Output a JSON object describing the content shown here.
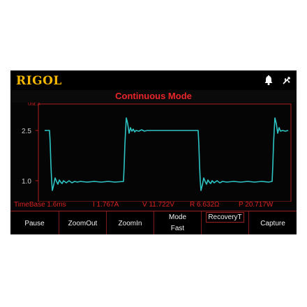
{
  "brand": "RIGOL",
  "mode_title": "Continuous Mode",
  "plot": {
    "y_unit_label": "Unit: A",
    "y_ticks": [
      "2.5",
      "1.0"
    ],
    "trace_color": "#2ec4c4",
    "frame_color": "#b01e1e"
  },
  "status": {
    "timebase": "TimeBase 1.6ms",
    "current": "I 1.767A",
    "voltage": "V 11.722V",
    "resistance": "R 6.632Ω",
    "power": "P 20.717W"
  },
  "softkeys": {
    "pause": "Pause",
    "zoom_out": "ZoomOut",
    "zoom_in": "ZoomIn",
    "mode_label": "Mode",
    "mode_value": "Fast",
    "recovery": "RecoveryT",
    "capture": "Capture"
  },
  "icons": {
    "bell": "bell-icon",
    "usb": "usb-icon"
  }
}
